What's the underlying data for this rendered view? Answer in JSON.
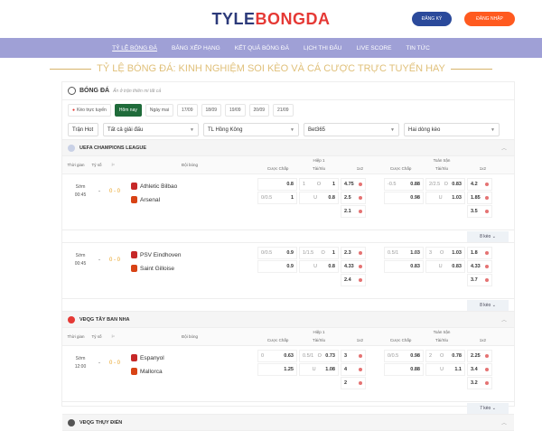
{
  "logo": {
    "part1": "TYLE",
    "part2": "BONGDA"
  },
  "header": {
    "register": "ĐĂNG KÝ",
    "login": "ĐĂNG NHẬP"
  },
  "nav": [
    "TỶ LỆ BÓNG ĐÁ",
    "BẢNG XẾP HẠNG",
    "KẾT QUẢ BÓNG ĐÁ",
    "LỊCH THI ĐẤU",
    "LIVE SCORE",
    "TIN TỨC"
  ],
  "headline": "TỶ LỆ BÓNG ĐÁ: KINH NGHIỆM SOI KÈO VÀ CÁ CƯỢC TRỰC TUYẾN HAY",
  "panel": {
    "title": "BÓNG ĐÁ",
    "subtitle": "Ấn ở trận thiên mi tất cả"
  },
  "tabs": [
    "Kèo trực tuyến",
    "Hôm nay",
    "Ngày mai",
    "17/09",
    "18/09",
    "19/09",
    "20/09",
    "21/09"
  ],
  "filters": {
    "hot": "Trận Hot",
    "league": "Tất cả giải đấu",
    "tz": "TL Hồng Kông",
    "book": "Bet365",
    "type": "Hai dòng kèo"
  },
  "columns": {
    "time": "Thời gian",
    "score": "Tỷ số",
    "team": "Đội bóng",
    "h1": "Hiệp 1",
    "ft": "Toàn trận",
    "hcap": "Cược Chấp",
    "ou": "Tài/Xỉu",
    "x12": "1x2"
  },
  "leagues": [
    {
      "name": "UEFA CHAMPIONS LEAGUE",
      "matches": [
        {
          "status": "Sớm",
          "time": "00:45",
          "score": "0 - 0",
          "home": "Athletic Bilbao",
          "away": "Arsenal",
          "more": "8 kèo",
          "h1": [
            [
              "",
              "0.8",
              "1",
              "O",
              "1",
              "4.75"
            ],
            [
              "0/0.5",
              "1",
              "",
              "U",
              "0.8",
              "2.5"
            ],
            [
              "",
              "",
              "",
              "",
              "",
              "2.1"
            ]
          ],
          "ft": [
            [
              "-0.5",
              "0.88",
              "2/2.5",
              "O",
              "0.83",
              "4.2"
            ],
            [
              "",
              "0.98",
              "",
              "U",
              "1.03",
              "1.85"
            ],
            [
              "",
              "",
              "",
              "",
              "",
              "3.5"
            ]
          ]
        },
        {
          "status": "Sớm",
          "time": "00:45",
          "score": "0 - 0",
          "home": "PSV Eindhoven",
          "away": "Saint Gilloise",
          "more": "8 kèo",
          "h1": [
            [
              "0/0.5",
              "0.9",
              "1/1.5",
              "O",
              "1",
              "2.3"
            ],
            [
              "",
              "0.9",
              "",
              "U",
              "0.8",
              "4.33"
            ],
            [
              "",
              "",
              "",
              "",
              "",
              "2.4"
            ]
          ],
          "ft": [
            [
              "0.5/1",
              "1.03",
              "3",
              "O",
              "1.03",
              "1.8"
            ],
            [
              "",
              "0.83",
              "",
              "U",
              "0.83",
              "4.33"
            ],
            [
              "",
              "",
              "",
              "",
              "",
              "3.7"
            ]
          ]
        }
      ]
    },
    {
      "name": "VĐQG TÂY BAN NHA",
      "matches": [
        {
          "status": "Sớm",
          "time": "12:00",
          "score": "0 - 0",
          "home": "Espanyol",
          "away": "Mallorca",
          "more": "7 kèo",
          "h1": [
            [
              "0",
              "0.63",
              "0.5/1",
              "O",
              "0.73",
              "3"
            ],
            [
              "",
              "1.25",
              "",
              "U",
              "1.08",
              "4"
            ],
            [
              "",
              "",
              "",
              "",
              "",
              "2"
            ]
          ],
          "ft": [
            [
              "0/0.5",
              "0.98",
              "2",
              "O",
              "0.78",
              "2.25"
            ],
            [
              "",
              "0.88",
              "",
              "U",
              "1.1",
              "3.4"
            ],
            [
              "",
              "",
              "",
              "",
              "",
              "3.2"
            ]
          ]
        }
      ]
    },
    {
      "name": "VĐQG THỤY ĐIỂN",
      "matches": []
    }
  ]
}
